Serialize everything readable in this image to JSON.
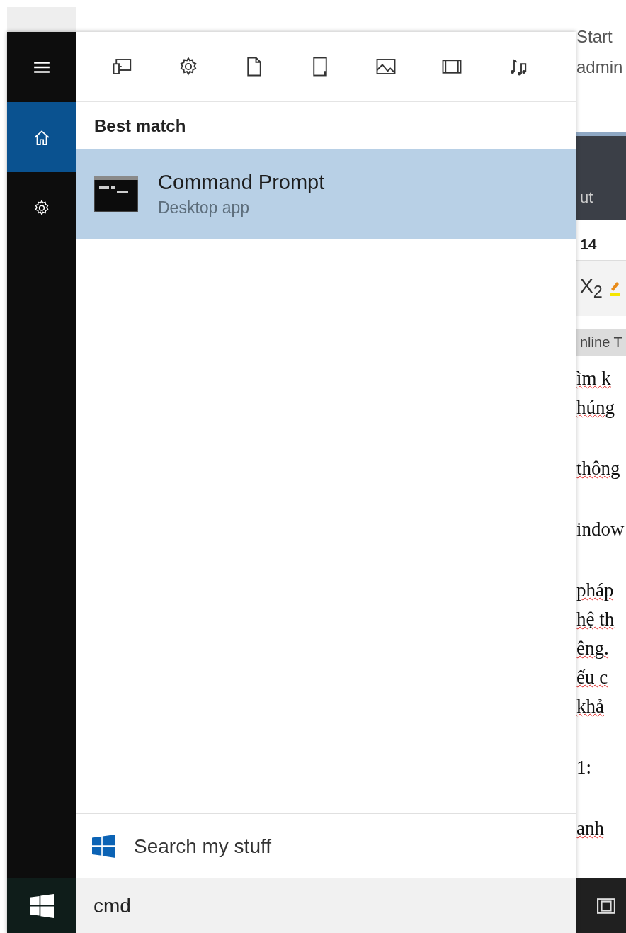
{
  "rail_items": [
    {
      "kind": "menu",
      "selected": false
    },
    {
      "kind": "home",
      "selected": true
    },
    {
      "kind": "settings",
      "selected": false
    }
  ],
  "filters": [
    {
      "kind": "apps"
    },
    {
      "kind": "settings"
    },
    {
      "kind": "documents"
    },
    {
      "kind": "folders"
    },
    {
      "kind": "photos"
    },
    {
      "kind": "videos"
    },
    {
      "kind": "music"
    }
  ],
  "section_heading": "Best match",
  "results": [
    {
      "title": "Command Prompt",
      "subtitle": "Desktop app",
      "selected": true
    }
  ],
  "search_my_stuff": "Search my stuff",
  "search": {
    "value": "cmd"
  },
  "background_window": {
    "title_lines": [
      "Start",
      "admin"
    ],
    "ribbon_tab": "ut",
    "font_size": "14",
    "subscript_button": "X$_{2}$",
    "group_label": "nline T",
    "paragraphs": [
      {
        "lines": [
          {
            "text": "ìm k",
            "misspelled": true
          },
          {
            "text": "húng",
            "misspelled": true
          }
        ]
      },
      {
        "lines": [
          {
            "text": "thông",
            "misspelled": true
          }
        ]
      },
      {
        "lines": [
          {
            "text": "indow",
            "misspelled": false
          }
        ]
      },
      {
        "lines": [
          {
            "text": "pháp",
            "misspelled": true
          },
          {
            "text": "hệ th",
            "misspelled": true
          },
          {
            "text": "êng.",
            "misspelled": true
          },
          {
            "text": "ếu c",
            "misspelled": true
          },
          {
            "text": "khả",
            "misspelled": true
          }
        ]
      },
      {
        "lines": [
          {
            "text": "1:",
            "misspelled": false
          }
        ]
      },
      {
        "lines": [
          {
            "text": "anh",
            "misspelled": true
          }
        ]
      }
    ]
  }
}
